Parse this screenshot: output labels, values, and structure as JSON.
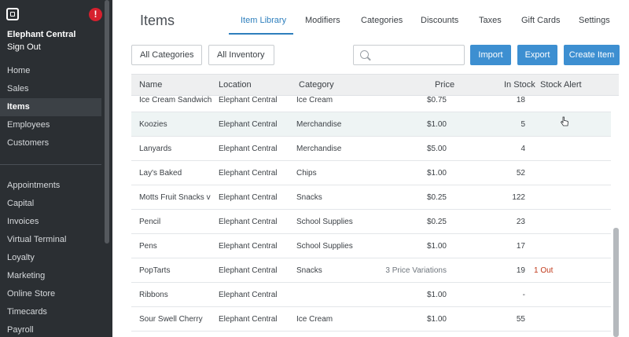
{
  "sidebar": {
    "business_name": "Elephant Central",
    "sign_out": "Sign Out",
    "alert_badge": "!",
    "primary_nav": [
      {
        "label": "Home"
      },
      {
        "label": "Sales"
      },
      {
        "label": "Items",
        "active": true
      },
      {
        "label": "Employees"
      },
      {
        "label": "Customers"
      }
    ],
    "secondary_nav": [
      {
        "label": "Appointments"
      },
      {
        "label": "Capital"
      },
      {
        "label": "Invoices"
      },
      {
        "label": "Virtual Terminal"
      },
      {
        "label": "Loyalty"
      },
      {
        "label": "Marketing"
      },
      {
        "label": "Online Store"
      },
      {
        "label": "Timecards"
      },
      {
        "label": "Payroll"
      }
    ]
  },
  "header": {
    "title": "Items",
    "tabs": [
      {
        "label": "Item Library",
        "active": true
      },
      {
        "label": "Modifiers"
      },
      {
        "label": "Categories"
      },
      {
        "label": "Discounts"
      },
      {
        "label": "Taxes"
      },
      {
        "label": "Gift Cards"
      },
      {
        "label": "Settings"
      }
    ]
  },
  "toolbar": {
    "category_filter": "All Categories",
    "inventory_filter": "All Inventory",
    "search_value": "",
    "search_placeholder": "",
    "import_label": "Import",
    "export_label": "Export",
    "create_label": "Create Item"
  },
  "table": {
    "columns": {
      "name": "Name",
      "location": "Location",
      "category": "Category",
      "price": "Price",
      "in_stock": "In Stock",
      "stock_alert": "Stock Alert"
    },
    "rows": [
      {
        "name": "Ice Cream Sandwich",
        "location": "Elephant Central",
        "category": "Ice Cream",
        "price": "$0.75",
        "in_stock": "18",
        "stock_alert": ""
      },
      {
        "name": "Koozies",
        "location": "Elephant Central",
        "category": "Merchandise",
        "price": "$1.00",
        "in_stock": "5",
        "stock_alert": ""
      },
      {
        "name": "Lanyards",
        "location": "Elephant Central",
        "category": "Merchandise",
        "price": "$5.00",
        "in_stock": "4",
        "stock_alert": ""
      },
      {
        "name": "Lay's Baked",
        "location": "Elephant Central",
        "category": "Chips",
        "price": "$1.00",
        "in_stock": "52",
        "stock_alert": ""
      },
      {
        "name": "Motts Fruit Snacks v",
        "location": "Elephant Central",
        "category": "Snacks",
        "price": "$0.25",
        "in_stock": "122",
        "stock_alert": ""
      },
      {
        "name": "Pencil",
        "location": "Elephant Central",
        "category": "School Supplies",
        "price": "$0.25",
        "in_stock": "23",
        "stock_alert": ""
      },
      {
        "name": "Pens",
        "location": "Elephant Central",
        "category": "School Supplies",
        "price": "$1.00",
        "in_stock": "17",
        "stock_alert": ""
      },
      {
        "name": "PopTarts",
        "location": "Elephant Central",
        "category": "Snacks",
        "price": "3 Price Variations",
        "in_stock": "19",
        "stock_alert": "1 Out"
      },
      {
        "name": "Ribbons",
        "location": "Elephant Central",
        "category": "",
        "price": "$1.00",
        "in_stock": "-",
        "stock_alert": ""
      },
      {
        "name": "Sour Swell Cherry",
        "location": "Elephant Central",
        "category": "Ice Cream",
        "price": "$1.00",
        "in_stock": "55",
        "stock_alert": ""
      }
    ]
  },
  "colors": {
    "sidebar_bg": "#2b2f33",
    "accent": "#3d8fd1",
    "tab_active": "#2e7fbd",
    "alert_red": "#c0391b",
    "badge_red": "#d6202e"
  }
}
